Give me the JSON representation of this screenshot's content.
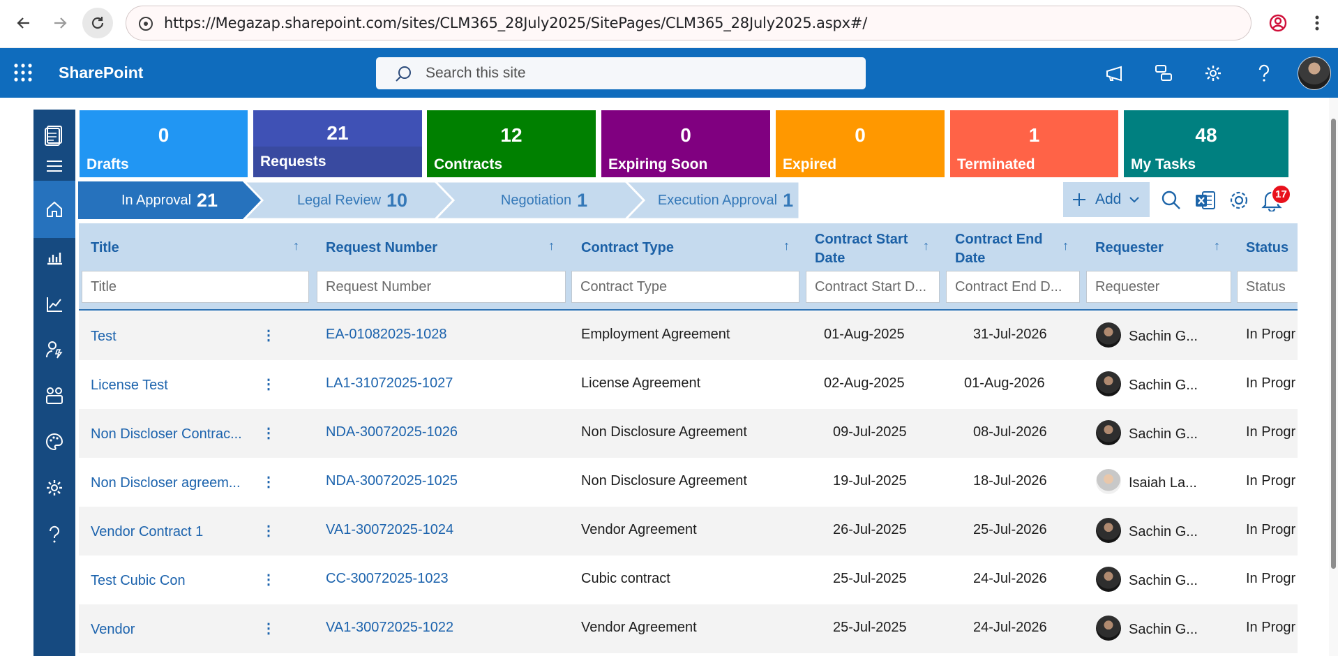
{
  "browser": {
    "url": "https://Megazap.sharepoint.com/sites/CLM365_28July2025/SitePages/CLM365_28July2025.aspx#/"
  },
  "suitebar": {
    "title": "SharePoint",
    "search_placeholder": "Search this site"
  },
  "tiles": [
    {
      "count": "0",
      "label": "Drafts",
      "color": "#2196f3"
    },
    {
      "count": "21",
      "label": "Requests",
      "color": "#3f51b5"
    },
    {
      "count": "12",
      "label": "Contracts",
      "color": "#008000"
    },
    {
      "count": "0",
      "label": "Expiring Soon",
      "color": "#800080"
    },
    {
      "count": "0",
      "label": "Expired",
      "color": "#ff9800"
    },
    {
      "count": "1",
      "label": "Terminated",
      "color": "#ff6347"
    },
    {
      "count": "48",
      "label": "My Tasks",
      "color": "#008080"
    }
  ],
  "stages": [
    {
      "label": "In Approval",
      "count": "21",
      "active": true
    },
    {
      "label": "Legal Review",
      "count": "10",
      "active": false
    },
    {
      "label": "Negotiation",
      "count": "1",
      "active": false
    },
    {
      "label": "Execution Approval",
      "count": "1",
      "active": false
    }
  ],
  "toolbar": {
    "add_label": "Add",
    "notification_count": "17"
  },
  "grid": {
    "columns": [
      {
        "label": "Title",
        "filter_placeholder": "Title"
      },
      {
        "label": "Request Number",
        "filter_placeholder": "Request Number"
      },
      {
        "label": "Contract Type",
        "filter_placeholder": "Contract Type"
      },
      {
        "label_line1": "Contract Start",
        "label_line2": "Date",
        "filter_placeholder": "Contract Start D..."
      },
      {
        "label_line1": "Contract End",
        "label_line2": "Date",
        "filter_placeholder": "Contract End D..."
      },
      {
        "label": "Requester",
        "filter_placeholder": "Requester"
      },
      {
        "label": "Status",
        "filter_placeholder": "Status"
      }
    ],
    "rows": [
      {
        "title": "Test",
        "request_number": "EA-01082025-1028",
        "contract_type": "Employment Agreement",
        "start": "01-Aug-2025",
        "end": "31-Jul-2026",
        "requester": "Sachin G...",
        "status": "In Progr"
      },
      {
        "title": "License Test",
        "request_number": "LA1-31072025-1027",
        "contract_type": "License Agreement",
        "start": "02-Aug-2025",
        "end": "01-Aug-2026",
        "requester": "Sachin G...",
        "status": "In Progr"
      },
      {
        "title": "Non Discloser Contrac...",
        "request_number": "NDA-30072025-1026",
        "contract_type": "Non Disclosure Agreement",
        "start": "09-Jul-2025",
        "end": "08-Jul-2026",
        "requester": "Sachin G...",
        "status": "In Progr"
      },
      {
        "title": "Non Discloser agreem...",
        "request_number": "NDA-30072025-1025",
        "contract_type": "Non Disclosure Agreement",
        "start": "19-Jul-2025",
        "end": "18-Jul-2026",
        "requester": "Isaiah La...",
        "status": "In Progr"
      },
      {
        "title": "Vendor Contract 1",
        "request_number": "VA1-30072025-1024",
        "contract_type": "Vendor Agreement",
        "start": "26-Jul-2025",
        "end": "25-Jul-2026",
        "requester": "Sachin G...",
        "status": "In Progr"
      },
      {
        "title": "Test Cubic Con",
        "request_number": "CC-30072025-1023",
        "contract_type": "Cubic contract",
        "start": "25-Jul-2025",
        "end": "24-Jul-2026",
        "requester": "Sachin G...",
        "status": "In Progr"
      },
      {
        "title": "Vendor",
        "request_number": "VA1-30072025-1022",
        "contract_type": "Vendor Agreement",
        "start": "25-Jul-2025",
        "end": "24-Jul-2026",
        "requester": "Sachin G...",
        "status": "In Progr"
      }
    ]
  }
}
